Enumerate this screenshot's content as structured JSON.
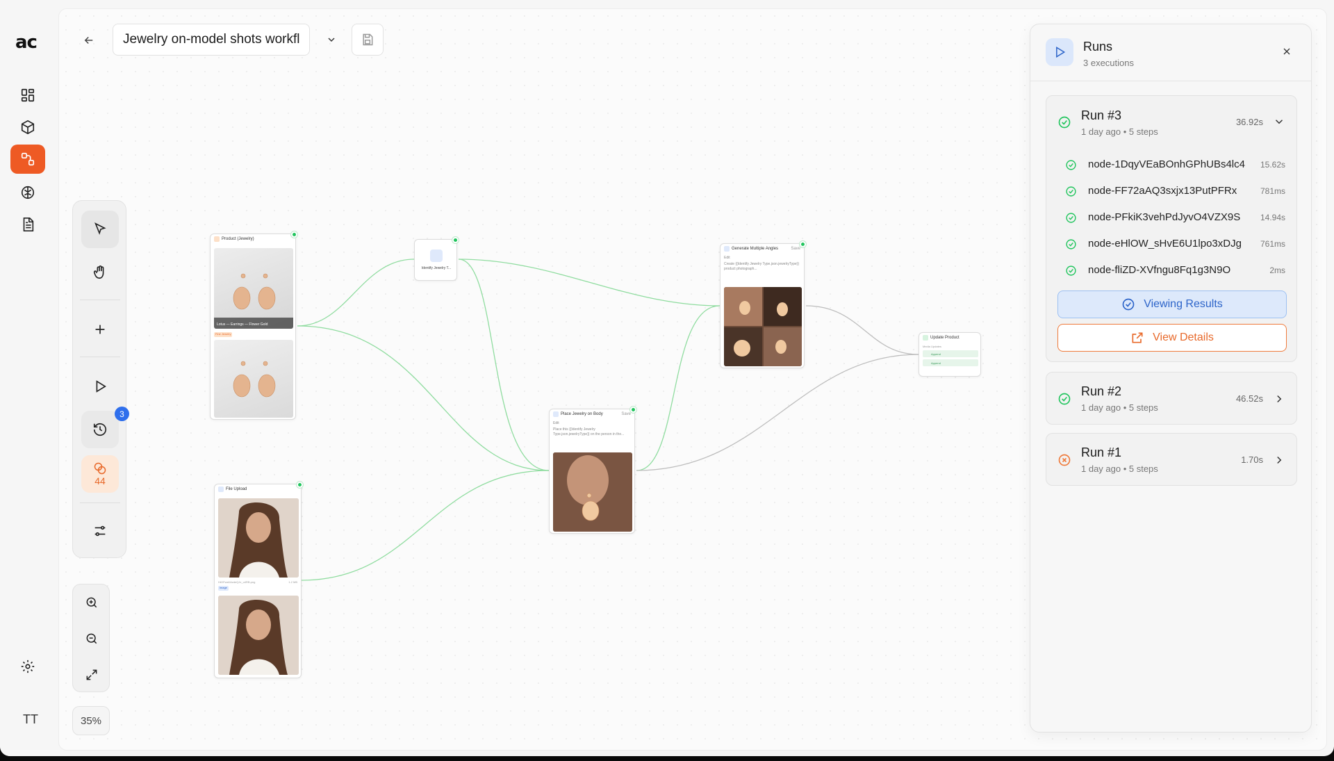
{
  "app": {
    "logo": "ac",
    "user_initials": "TT"
  },
  "workflow": {
    "title": "Jewelry on-model shots workfl"
  },
  "toolbar": {
    "history_badge": "3",
    "credits": "44"
  },
  "zoom": {
    "level": "35%"
  },
  "nodes": {
    "product": {
      "title": "Product (Jewelry)",
      "caption": "Lotus — Earrings — Flower Gold",
      "tag": "Fine Jewelry"
    },
    "identify": {
      "title": "Identify Jewelry T..."
    },
    "angles": {
      "title": "Generate Multiple Angles",
      "action": "Save",
      "edit": "Edit",
      "prompt": "Create {{Identify Jewelry Type.json.jewelryType}} product photograph..."
    },
    "place": {
      "title": "Place Jewelry on Body",
      "action": "Save",
      "edit": "Edit",
      "prompt": "Place this {{Identify Jewelry Type.json.jewelryType}} on the person in the..."
    },
    "update": {
      "title": "Update Product",
      "sub": "Media Updates",
      "row1": "Append",
      "row2": "Append"
    },
    "upload": {
      "title": "File Upload",
      "file": "HtGFwsKAzdeQJx_u4RB.png",
      "size": "1.2 MB",
      "tag": "image"
    }
  },
  "runs": {
    "title": "Runs",
    "subtitle": "3 executions",
    "items": [
      {
        "name": "Run #3",
        "meta": "1 day ago • 5 steps",
        "duration": "36.92s",
        "status": "success",
        "steps": [
          {
            "name": "node-1DqyVEaBOnhGPhUBs4lc4",
            "duration": "15.62s"
          },
          {
            "name": "node-FF72aAQ3sxjx13PutPFRx",
            "duration": "781ms"
          },
          {
            "name": "node-PFkiK3vehPdJyvO4VZX9S",
            "duration": "14.94s"
          },
          {
            "name": "node-eHlOW_sHvE6U1lpo3xDJg",
            "duration": "761ms"
          },
          {
            "name": "node-fliZD-XVfngu8Fq1g3N9O",
            "duration": "2ms"
          }
        ],
        "viewing_label": "Viewing Results",
        "details_label": "View Details"
      },
      {
        "name": "Run #2",
        "meta": "1 day ago • 5 steps",
        "duration": "46.52s",
        "status": "success"
      },
      {
        "name": "Run #1",
        "meta": "1 day ago • 5 steps",
        "duration": "1.70s",
        "status": "failed"
      }
    ]
  },
  "colors": {
    "accent": "#ee5a24",
    "success": "#22c55e",
    "error": "#ef7a3b",
    "info": "#2c64c9",
    "edge": "#8fdc9f",
    "edge_muted": "#bdbdbd"
  }
}
